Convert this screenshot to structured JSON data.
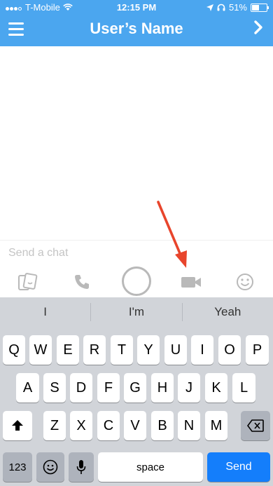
{
  "status_bar": {
    "carrier": "T-Mobile",
    "time": "12:15 PM",
    "battery": "51%",
    "battery_level": 0.51
  },
  "header": {
    "title": "User’s Name",
    "menu_icon": "hamburger-menu-icon",
    "next_icon": "chevron-right-icon"
  },
  "chat": {
    "placeholder": "Send a chat"
  },
  "action_bar": {
    "items": [
      "sticker-icon",
      "phone-icon",
      "capture-button",
      "video-call-icon",
      "emoji-icon"
    ]
  },
  "keyboard": {
    "suggestions": [
      "I",
      "I'm",
      "Yeah"
    ],
    "rows": [
      [
        "Q",
        "W",
        "E",
        "R",
        "T",
        "Y",
        "U",
        "I",
        "O",
        "P"
      ],
      [
        "A",
        "S",
        "D",
        "F",
        "G",
        "H",
        "J",
        "K",
        "L"
      ],
      [
        "Z",
        "X",
        "C",
        "V",
        "B",
        "N",
        "M"
      ]
    ],
    "numbers_key": "123",
    "space_key": "space",
    "send_key": "Send"
  },
  "colors": {
    "header": "#4ba6ef",
    "annotation_arrow": "#e8452c",
    "send_key": "#147efb"
  }
}
